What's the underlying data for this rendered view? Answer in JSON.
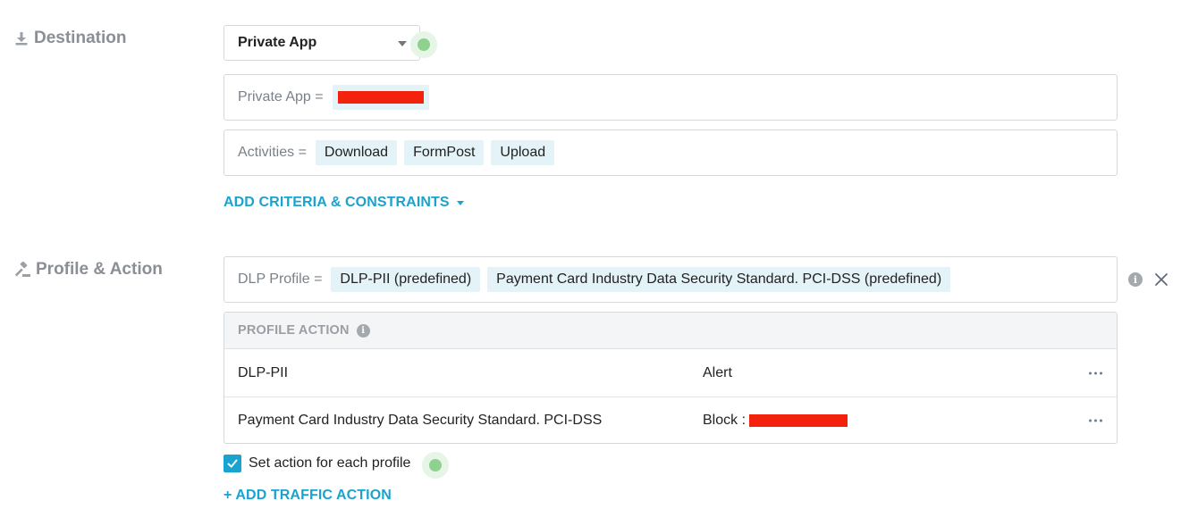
{
  "destination": {
    "label": "Destination",
    "dropdown_value": "Private App",
    "private_app_criteria": {
      "label": "Private App ="
    },
    "activities_criteria": {
      "label": "Activities =",
      "chips": [
        "Download",
        "FormPost",
        "Upload"
      ]
    },
    "add_criteria_label": "ADD CRITERIA & CONSTRAINTS"
  },
  "profile_action": {
    "label": "Profile & Action",
    "dlp_profile": {
      "label": "DLP Profile =",
      "chips": [
        "DLP-PII (predefined)",
        "Payment Card Industry Data Security Standard. PCI-DSS (predefined)"
      ]
    },
    "table": {
      "header": "PROFILE ACTION",
      "rows": [
        {
          "name": "DLP-PII",
          "action": "Alert"
        },
        {
          "name": "Payment Card Industry Data Security Standard. PCI-DSS",
          "action": "Block :"
        }
      ]
    },
    "set_action_label": "Set action for each profile",
    "add_traffic_action_label": "+ ADD TRAFFIC ACTION"
  },
  "colors": {
    "accent": "#1aa3cf",
    "chip_bg": "#e4f3f8",
    "redaction": "#f2220c",
    "status_dot": "#8fd18f"
  },
  "icons": {
    "destination": "download-icon",
    "profile": "gavel-icon",
    "info": "info-icon",
    "close": "close-icon",
    "more": "more-horizontal-icon",
    "checkbox": "check-icon"
  }
}
